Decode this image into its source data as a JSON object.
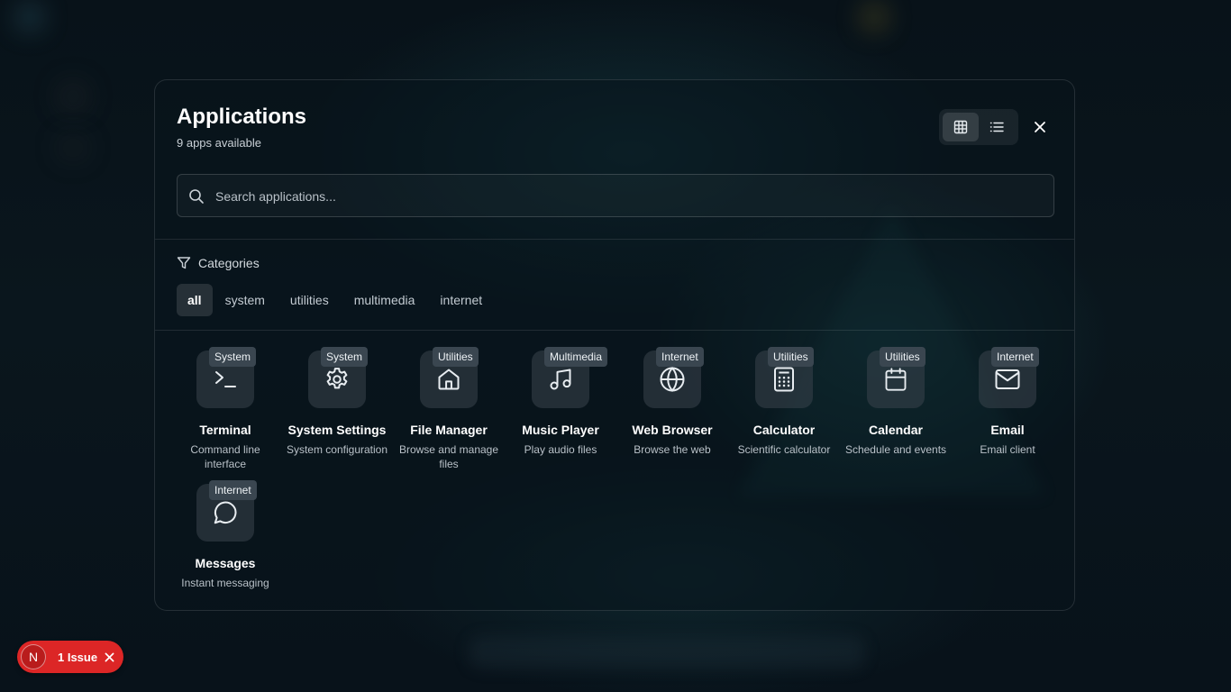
{
  "launcher": {
    "title": "Applications",
    "count_text": "9 apps available",
    "view_modes": [
      "grid",
      "list"
    ],
    "active_view": "grid"
  },
  "search": {
    "placeholder": "Search applications..."
  },
  "categories": {
    "label": "Categories",
    "tabs": [
      {
        "label": "all",
        "active": true
      },
      {
        "label": "system",
        "active": false
      },
      {
        "label": "utilities",
        "active": false
      },
      {
        "label": "multimedia",
        "active": false
      },
      {
        "label": "internet",
        "active": false
      }
    ]
  },
  "apps": [
    {
      "name": "Terminal",
      "description": "Command line interface",
      "category": "System",
      "icon": "terminal-icon"
    },
    {
      "name": "System Settings",
      "description": "System configuration",
      "category": "System",
      "icon": "gear-icon"
    },
    {
      "name": "File Manager",
      "description": "Browse and manage files",
      "category": "Utilities",
      "icon": "home-icon"
    },
    {
      "name": "Music Player",
      "description": "Play audio files",
      "category": "Multimedia",
      "icon": "music-icon"
    },
    {
      "name": "Web Browser",
      "description": "Browse the web",
      "category": "Internet",
      "icon": "globe-icon"
    },
    {
      "name": "Calculator",
      "description": "Scientific calculator",
      "category": "Utilities",
      "icon": "calculator-icon"
    },
    {
      "name": "Calendar",
      "description": "Schedule and events",
      "category": "Utilities",
      "icon": "calendar-icon"
    },
    {
      "name": "Email",
      "description": "Email client",
      "category": "Internet",
      "icon": "mail-icon"
    },
    {
      "name": "Messages",
      "description": "Instant messaging",
      "category": "Internet",
      "icon": "message-icon"
    }
  ],
  "issue_badge": {
    "avatar_letter": "N",
    "label": "1 Issue",
    "color": "#dc2626"
  }
}
